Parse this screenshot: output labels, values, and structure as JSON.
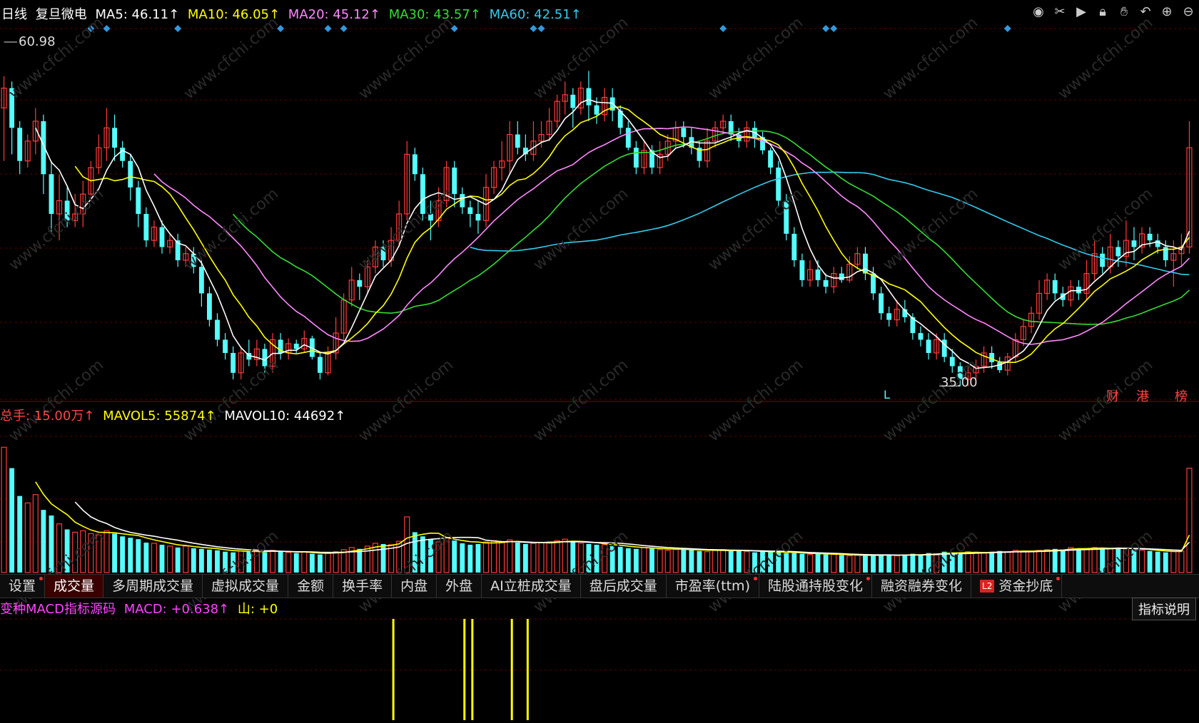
{
  "header": {
    "period": "日线",
    "stock": "复旦微电",
    "ma5": "MA5: 46.11↑",
    "ma10": "MA10: 46.05↑",
    "ma20": "MA20: 45.12↑",
    "ma30": "MA30: 43.57↑",
    "ma60": "MA60: 42.51↑"
  },
  "colors": {
    "up": "#ff3b3b",
    "down": "#54ffff",
    "ma5": "#ffffff",
    "ma10": "#ffff00",
    "ma20": "#ff88ff",
    "ma30": "#33dd33",
    "ma60": "#33ccee",
    "grid": "#5a0000"
  },
  "price_labels": {
    "high": "60.98",
    "low": "35.00",
    "low_marker": "L"
  },
  "badges": [
    "财",
    "港",
    "榜"
  ],
  "volume_header": {
    "total": "总手: 15.00万↑",
    "mavol5": "MAVOL5: 55874↑",
    "mavol10": "MAVOL10: 44692↑"
  },
  "tabs": [
    {
      "label": "设置",
      "dot": true
    },
    {
      "label": "成交量",
      "active": true
    },
    {
      "label": "多周期成交量"
    },
    {
      "label": "虚拟成交量"
    },
    {
      "label": "金额"
    },
    {
      "label": "换手率"
    },
    {
      "label": "内盘"
    },
    {
      "label": "外盘"
    },
    {
      "label": "AI立桩成交量"
    },
    {
      "label": "盘后成交量"
    },
    {
      "label": "市盈率(ttm)",
      "dot": true
    },
    {
      "label": "陆股通持股变化",
      "dot": true
    },
    {
      "label": "融资融券变化"
    },
    {
      "label": "资金抄底",
      "dot": true,
      "l2": "L2"
    }
  ],
  "macd_header": {
    "name": "变种MACD指标源码",
    "macd": "MACD: +0.638↑",
    "shan": "山: +0"
  },
  "indicator_button": "指标说明",
  "toolbar_icons": [
    "eye-icon",
    "scissors-icon",
    "play-icon",
    "lock-icon",
    "hand-icon",
    "undo-icon",
    "zoom-in-icon",
    "zoom-out-icon"
  ],
  "chart_data": [
    {
      "type": "candlestick",
      "title": "复旦微电 日线",
      "ylim": [
        34,
        62
      ],
      "high_marker": 60.98,
      "low_marker": 35.0,
      "candles": [
        [
          56,
          57.5,
          52,
          58.4
        ],
        [
          57.5,
          54.5,
          52.5,
          58
        ],
        [
          54.5,
          52,
          51,
          55
        ],
        [
          52,
          53.5,
          51.5,
          54
        ],
        [
          53.5,
          55,
          52.5,
          56
        ],
        [
          55,
          51,
          49.5,
          55.5
        ],
        [
          51,
          48,
          46.5,
          52
        ],
        [
          48,
          49,
          46,
          51
        ],
        [
          49,
          47.5,
          47,
          50
        ],
        [
          47.5,
          48,
          47,
          49.5
        ],
        [
          48,
          49.5,
          47,
          50.5
        ],
        [
          49.5,
          51.5,
          49,
          52
        ],
        [
          51.5,
          53,
          51,
          54
        ],
        [
          53,
          54.5,
          52,
          56
        ],
        [
          54.5,
          53,
          52,
          55.5
        ],
        [
          53,
          52,
          51.5,
          53.5
        ],
        [
          52,
          50,
          49,
          52.5
        ],
        [
          50,
          48,
          47,
          50.5
        ],
        [
          48,
          46,
          45.5,
          48.5
        ],
        [
          46,
          47,
          45.5,
          47.5
        ],
        [
          47,
          45.5,
          45,
          47.5
        ],
        [
          45.5,
          46,
          45,
          46.5
        ],
        [
          46,
          44.5,
          44,
          46.5
        ],
        [
          44.5,
          45,
          44,
          45.5
        ],
        [
          45,
          44,
          43.5,
          45.5
        ],
        [
          44,
          42,
          41,
          44.5
        ],
        [
          42,
          40,
          39.5,
          42.5
        ],
        [
          40,
          38.5,
          38,
          40.5
        ],
        [
          38.5,
          37.5,
          37,
          39
        ],
        [
          37.5,
          36,
          35.5,
          38
        ],
        [
          36,
          37.5,
          35.5,
          38
        ],
        [
          37.5,
          37,
          36.5,
          38.5
        ],
        [
          37,
          37.8,
          36.5,
          38.5
        ],
        [
          37.8,
          36.5,
          36,
          38.2
        ],
        [
          36.5,
          38.5,
          36,
          39
        ],
        [
          38.5,
          37.5,
          37,
          39
        ],
        [
          37.5,
          38.2,
          37,
          38.6
        ],
        [
          38.2,
          37.8,
          37.5,
          38.5
        ],
        [
          37.8,
          38.6,
          37.5,
          39.2
        ],
        [
          38.6,
          37.2,
          37,
          38.8
        ],
        [
          37.2,
          36,
          35.5,
          37.5
        ],
        [
          36,
          37.5,
          35.8,
          38
        ],
        [
          37.5,
          39,
          37,
          40.2
        ],
        [
          39,
          41.5,
          38.5,
          42
        ],
        [
          41.5,
          43,
          41,
          44
        ],
        [
          43,
          42.5,
          41.5,
          43.5
        ],
        [
          42.5,
          44,
          42,
          44.5
        ],
        [
          44,
          45.5,
          43.5,
          46
        ],
        [
          45.5,
          44.5,
          44,
          46
        ],
        [
          44.5,
          46,
          44,
          47
        ],
        [
          46,
          48,
          45.5,
          49
        ],
        [
          48,
          52.5,
          47.5,
          53.5
        ],
        [
          52.5,
          51,
          50.5,
          53
        ],
        [
          51,
          48,
          47.5,
          51.5
        ],
        [
          48,
          47.5,
          46,
          49
        ],
        [
          47.5,
          49,
          47,
          50
        ],
        [
          49,
          51.5,
          48.5,
          52
        ],
        [
          51.5,
          49.5,
          48.5,
          52
        ],
        [
          49.5,
          48.5,
          48,
          50
        ],
        [
          48.5,
          48,
          47,
          49
        ],
        [
          48,
          47.5,
          46.5,
          49
        ],
        [
          47.5,
          50,
          47,
          51
        ],
        [
          50,
          51.5,
          49.5,
          52
        ],
        [
          51.5,
          52,
          50.5,
          53.5
        ],
        [
          52,
          54,
          51,
          55
        ],
        [
          54,
          53,
          52.5,
          55
        ],
        [
          53,
          52.5,
          52,
          54
        ],
        [
          52.5,
          53.5,
          52,
          55
        ],
        [
          53.5,
          54,
          53,
          55
        ],
        [
          54,
          55,
          53.5,
          56
        ],
        [
          55,
          56.5,
          54.5,
          57
        ],
        [
          56.5,
          57,
          55.5,
          58
        ],
        [
          57,
          56,
          54.5,
          57.5
        ],
        [
          56,
          57.5,
          55.5,
          58
        ],
        [
          57.5,
          56.2,
          55,
          58.8
        ],
        [
          56.2,
          55.5,
          54.8,
          56.8
        ],
        [
          55.5,
          56.8,
          55,
          57.5
        ],
        [
          56.8,
          55.8,
          55,
          57.5
        ],
        [
          55.8,
          54.5,
          54,
          56.2
        ],
        [
          54.5,
          53,
          52.8,
          55
        ],
        [
          53,
          51.5,
          51,
          53.5
        ],
        [
          51.5,
          52.8,
          51,
          53.5
        ],
        [
          52.8,
          51.5,
          51,
          53.2
        ],
        [
          51.5,
          52.5,
          51,
          53.5
        ],
        [
          52.5,
          53.5,
          52,
          54
        ],
        [
          53.5,
          54.5,
          53,
          55
        ],
        [
          54.5,
          53.8,
          53,
          55
        ],
        [
          53.8,
          53,
          52.5,
          54.5
        ],
        [
          53,
          52,
          51.5,
          53.5
        ],
        [
          52,
          53.5,
          51.5,
          54.5
        ],
        [
          53.5,
          54.5,
          53,
          55
        ],
        [
          54.5,
          55,
          54,
          55.5
        ],
        [
          55,
          54,
          53.5,
          55.5
        ],
        [
          54,
          53.5,
          53,
          54.5
        ],
        [
          53.5,
          54.5,
          53,
          55
        ],
        [
          54.5,
          53.8,
          53,
          55
        ],
        [
          53.8,
          52.8,
          52.5,
          54.2
        ],
        [
          52.8,
          51.5,
          51,
          53
        ],
        [
          51.5,
          49,
          48.5,
          52
        ],
        [
          49,
          46.5,
          46,
          49.5
        ],
        [
          46.5,
          44.5,
          44,
          47
        ],
        [
          44.5,
          43,
          42.5,
          45
        ],
        [
          43,
          43.8,
          42.5,
          44.5
        ],
        [
          43.8,
          43,
          42.5,
          44.5
        ],
        [
          43,
          42.5,
          42,
          43.5
        ],
        [
          42.5,
          43.5,
          42,
          44
        ],
        [
          43.5,
          43,
          42.8,
          44
        ],
        [
          43,
          44.2,
          42.8,
          44.8
        ],
        [
          44.2,
          45,
          43.8,
          45.5
        ],
        [
          45,
          43.5,
          43,
          45.5
        ],
        [
          43.5,
          42,
          41.5,
          44
        ],
        [
          42,
          40.5,
          40,
          42.5
        ],
        [
          40.5,
          40,
          39.5,
          41
        ],
        [
          40,
          40.8,
          39.5,
          41.5
        ],
        [
          40.8,
          40.2,
          39.8,
          41.5
        ],
        [
          40.2,
          39,
          38.5,
          40.5
        ],
        [
          39,
          38.5,
          38,
          39.5
        ],
        [
          38.5,
          37.5,
          37,
          39
        ],
        [
          37.5,
          38.5,
          37,
          39
        ],
        [
          38.5,
          37.2,
          36.8,
          39
        ],
        [
          37.2,
          36.5,
          36,
          37.8
        ],
        [
          36.5,
          35.5,
          35,
          36.8
        ],
        [
          35.5,
          36,
          35,
          36.5
        ],
        [
          36,
          36.5,
          35.5,
          37
        ],
        [
          36.5,
          37.5,
          36,
          38
        ],
        [
          37.5,
          36.8,
          36.3,
          38
        ],
        [
          36.8,
          36.2,
          36,
          37.2
        ],
        [
          36.2,
          37.2,
          35.8,
          37.5
        ],
        [
          37.2,
          38.5,
          36.8,
          39
        ],
        [
          38.5,
          39.5,
          38,
          40
        ],
        [
          39.5,
          40.5,
          39,
          41
        ],
        [
          40.5,
          42,
          40,
          43
        ],
        [
          42,
          43,
          41.5,
          43.5
        ],
        [
          43,
          42,
          41.5,
          43.5
        ],
        [
          42,
          41.5,
          41,
          42.5
        ],
        [
          41.5,
          42.5,
          41,
          43
        ],
        [
          42.5,
          42,
          41.5,
          43
        ],
        [
          42,
          43.5,
          41.5,
          44.5
        ],
        [
          43.5,
          45,
          43,
          46
        ],
        [
          45,
          44,
          43.5,
          45.5
        ],
        [
          44,
          45.5,
          43.5,
          46.5
        ],
        [
          45.5,
          44.8,
          44,
          46
        ],
        [
          44.8,
          46,
          44,
          47.5
        ],
        [
          46,
          45.5,
          44.5,
          47
        ],
        [
          45.5,
          46.5,
          45,
          47
        ],
        [
          46.5,
          46,
          45.5,
          47
        ],
        [
          46,
          45.5,
          45,
          46.5
        ],
        [
          45.5,
          44.5,
          44,
          46
        ],
        [
          44.5,
          45,
          42.5,
          46
        ],
        [
          45,
          45.5,
          44,
          46.5
        ],
        [
          45.5,
          53,
          45,
          55
        ]
      ]
    },
    {
      "type": "bar",
      "title": "成交量",
      "ylim": [
        0,
        210000
      ],
      "values": [
        180000,
        150000,
        110000,
        100000,
        112000,
        90000,
        82000,
        70000,
        62000,
        58000,
        60000,
        56000,
        54000,
        60000,
        56000,
        52000,
        50000,
        48000,
        43000,
        42000,
        40000,
        38000,
        36000,
        38000,
        35000,
        34000,
        33000,
        32000,
        30000,
        29000,
        31000,
        30000,
        31000,
        29000,
        32000,
        30000,
        29000,
        28000,
        30000,
        27000,
        26000,
        28000,
        30000,
        33000,
        36000,
        34000,
        38000,
        42000,
        41000,
        40000,
        45000,
        80000,
        58000,
        52000,
        48000,
        44000,
        50000,
        46000,
        42000,
        40000,
        41000,
        44000,
        46000,
        44000,
        47000,
        43000,
        41000,
        42000,
        43000,
        44000,
        46000,
        48000,
        44000,
        42000,
        41000,
        40000,
        40000,
        38000,
        37000,
        35000,
        34000,
        36000,
        35000,
        33000,
        32000,
        33000,
        34000,
        33000,
        31000,
        30000,
        32000,
        33000,
        32000,
        31000,
        30000,
        29000,
        30000,
        30000,
        29000,
        28000,
        28000,
        27000,
        26000,
        27000,
        26000,
        26000,
        25000,
        24000,
        25000,
        24000,
        26000,
        25000,
        26000,
        24000,
        25000,
        27000,
        26000,
        28000,
        27000,
        30000,
        29000,
        28000,
        30000,
        29000,
        28000,
        30000,
        31000,
        30000,
        32000,
        31000,
        30000,
        32000,
        33000,
        34000,
        33000,
        36000,
        35000,
        34000,
        36000,
        35000,
        34000,
        36000,
        34000,
        33000,
        32000,
        31000,
        30000,
        29000,
        30000,
        31000,
        150000
      ]
    },
    {
      "type": "bar",
      "title": "变种MACD指标源码",
      "spikes": [
        0,
        0,
        0,
        0,
        0
      ]
    }
  ]
}
